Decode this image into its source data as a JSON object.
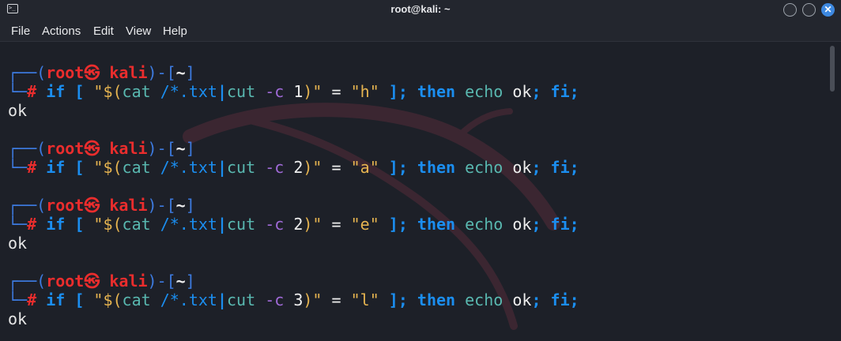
{
  "window": {
    "title": "root@kali: ~",
    "close_glyph": "✕"
  },
  "menu": [
    "File",
    "Actions",
    "Edit",
    "View",
    "Help"
  ],
  "prompt": {
    "open": "┌──(",
    "user": "root㉿ kali",
    "close": ")-[",
    "dir": "~",
    "end": "]",
    "corner": "└─",
    "hash": "#"
  },
  "commands": [
    {
      "char_index": "1",
      "compare": "\"h\"",
      "output": "ok"
    },
    {
      "char_index": "2",
      "compare": "\"a\"",
      "output": ""
    },
    {
      "char_index": "2",
      "compare": "\"e\"",
      "output": "ok"
    },
    {
      "char_index": "3",
      "compare": "\"l\"",
      "output": "ok"
    }
  ],
  "tokens": {
    "if": "if",
    "lbr": "[",
    "q_open": "\"$(",
    "cat": "cat",
    "glob_path": "/*.txt",
    "pipe": "|",
    "cut": "cut",
    "opt": "-c",
    "q_close": ")\"",
    "eq": "=",
    "rbr": "];",
    "then": "then",
    "echo": "echo",
    "ok": "ok",
    "semi": ";",
    "fi": "fi;"
  },
  "colors": {
    "background": "#1d2028",
    "frame": "#3d7be0",
    "user": "#ea2d2d",
    "keyword": "#1b8ef0",
    "string": "#e6b450",
    "command": "#59b8b0",
    "option": "#a06ad8"
  }
}
